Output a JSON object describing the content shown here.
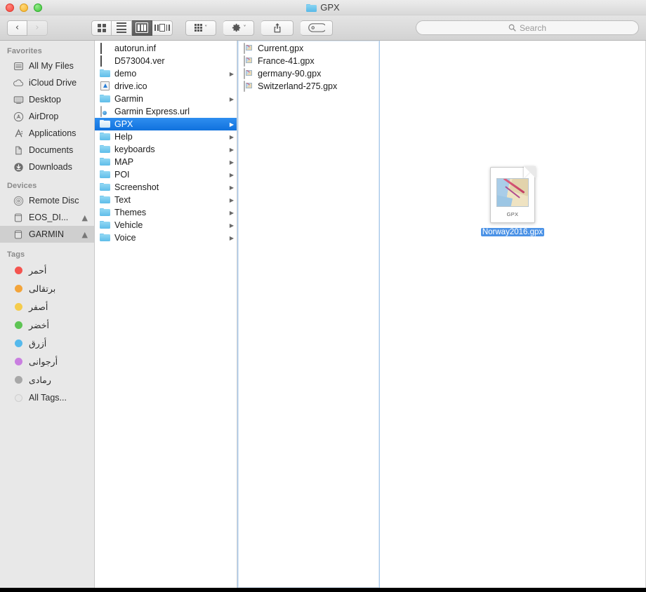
{
  "window": {
    "title": "GPX",
    "title_icon": "folder-icon",
    "traffic_lights": [
      {
        "name": "close-button",
        "color": "#f5453c"
      },
      {
        "name": "minimize-button",
        "color": "#f6b429"
      },
      {
        "name": "zoom-button",
        "color": "#3ec73a"
      }
    ]
  },
  "toolbar": {
    "back_label": "‹",
    "forward_label": "›",
    "view_modes": [
      {
        "name": "icon-view",
        "label": "Icon View",
        "active": false
      },
      {
        "name": "list-view",
        "label": "List View",
        "active": false
      },
      {
        "name": "column-view",
        "label": "Column View",
        "active": true
      },
      {
        "name": "coverflow-view",
        "label": "Cover Flow View",
        "active": false
      }
    ],
    "arrange_label": "Arrange",
    "action_label": "Action",
    "share_label": "Share",
    "tag_label": "Edit Tags",
    "chevron": "˅"
  },
  "search": {
    "placeholder": "Search",
    "value": "",
    "icon": "search-icon"
  },
  "sidebar": {
    "sections": [
      {
        "header": "Favorites",
        "items": [
          {
            "label": "All My Files",
            "icon": "all-my-files-icon",
            "selected": false
          },
          {
            "label": "iCloud Drive",
            "icon": "icloud-icon",
            "selected": false
          },
          {
            "label": "Desktop",
            "icon": "desktop-icon",
            "selected": false
          },
          {
            "label": "AirDrop",
            "icon": "airdrop-icon",
            "selected": false
          },
          {
            "label": "Applications",
            "icon": "applications-icon",
            "selected": false
          },
          {
            "label": "Documents",
            "icon": "documents-icon",
            "selected": false
          },
          {
            "label": "Downloads",
            "icon": "downloads-icon",
            "selected": false
          }
        ]
      },
      {
        "header": "Devices",
        "items": [
          {
            "label": "Remote Disc",
            "icon": "remote-disc-icon",
            "selected": false,
            "eject": false
          },
          {
            "label": "EOS_DI...",
            "icon": "drive-icon",
            "selected": false,
            "eject": true
          },
          {
            "label": "GARMIN",
            "icon": "drive-icon",
            "selected": true,
            "eject": true
          }
        ]
      }
    ],
    "tags_header": "Tags",
    "tags": [
      {
        "label": "أحمر",
        "color": "#f4544f"
      },
      {
        "label": "برتقالى",
        "color": "#f3a43a"
      },
      {
        "label": "أصفر",
        "color": "#f5cc4c"
      },
      {
        "label": "أخضر",
        "color": "#5ec454"
      },
      {
        "label": "أزرق",
        "color": "#55b9ec"
      },
      {
        "label": "أرجوانى",
        "color": "#c97fe0"
      },
      {
        "label": "رمادى",
        "color": "#a8a8a8"
      }
    ],
    "all_tags_label": "All Tags...",
    "all_tags_color": "#e0e0e0"
  },
  "columns": [
    {
      "name": "column-root",
      "items": [
        {
          "label": "autorun.inf",
          "icon": "dark-file-icon",
          "kind": "file",
          "disclosure": false,
          "selected": false
        },
        {
          "label": "D573004.ver",
          "icon": "dark-file-icon",
          "kind": "file",
          "disclosure": false,
          "selected": false
        },
        {
          "label": "demo",
          "icon": "folder-icon",
          "kind": "folder",
          "disclosure": true,
          "selected": false
        },
        {
          "label": "drive.ico",
          "icon": "image-file-icon",
          "kind": "file",
          "disclosure": false,
          "selected": false
        },
        {
          "label": "Garmin",
          "icon": "folder-icon",
          "kind": "folder",
          "disclosure": true,
          "selected": false
        },
        {
          "label": "Garmin Express.url",
          "icon": "url-file-icon",
          "kind": "file",
          "disclosure": false,
          "selected": false
        },
        {
          "label": "GPX",
          "icon": "folder-icon",
          "kind": "folder",
          "disclosure": true,
          "selected": true
        },
        {
          "label": "Help",
          "icon": "folder-icon",
          "kind": "folder",
          "disclosure": true,
          "selected": false
        },
        {
          "label": "keyboards",
          "icon": "folder-icon",
          "kind": "folder",
          "disclosure": true,
          "selected": false
        },
        {
          "label": "MAP",
          "icon": "folder-icon",
          "kind": "folder",
          "disclosure": true,
          "selected": false
        },
        {
          "label": "POI",
          "icon": "folder-icon",
          "kind": "folder",
          "disclosure": true,
          "selected": false
        },
        {
          "label": "Screenshot",
          "icon": "folder-icon",
          "kind": "folder",
          "disclosure": true,
          "selected": false
        },
        {
          "label": "Text",
          "icon": "folder-icon",
          "kind": "folder",
          "disclosure": true,
          "selected": false
        },
        {
          "label": "Themes",
          "icon": "folder-icon",
          "kind": "folder",
          "disclosure": true,
          "selected": false
        },
        {
          "label": "Vehicle",
          "icon": "folder-icon",
          "kind": "folder",
          "disclosure": true,
          "selected": false
        },
        {
          "label": "Voice",
          "icon": "folder-icon",
          "kind": "folder",
          "disclosure": true,
          "selected": false
        }
      ]
    },
    {
      "name": "column-gpx",
      "focused": true,
      "items": [
        {
          "label": "Current.gpx",
          "icon": "gpx-file-icon",
          "kind": "file",
          "disclosure": false,
          "selected": false
        },
        {
          "label": "France-41.gpx",
          "icon": "gpx-file-icon",
          "kind": "file",
          "disclosure": false,
          "selected": false
        },
        {
          "label": "germany-90.gpx",
          "icon": "gpx-file-icon",
          "kind": "file",
          "disclosure": false,
          "selected": false
        },
        {
          "label": "Switzerland-275.gpx",
          "icon": "gpx-file-icon",
          "kind": "file",
          "disclosure": false,
          "selected": false
        }
      ]
    }
  ],
  "preview": {
    "name": "Norway2016.gpx",
    "file_type_label": "GPX",
    "icon": "gpx-document-icon",
    "selection_color": "#4b92e6"
  }
}
